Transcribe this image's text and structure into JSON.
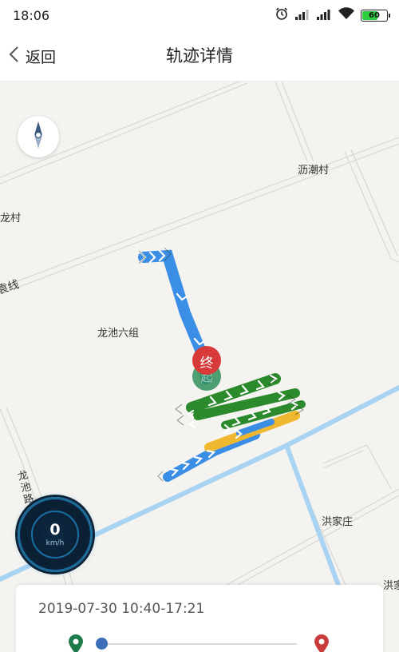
{
  "status_bar": {
    "time": "18:06",
    "battery": "60",
    "icons": [
      "alarm-icon",
      "signal-icon",
      "signal-icon",
      "wifi-icon",
      "battery-icon"
    ]
  },
  "header": {
    "back_label": "返回",
    "title": "轨迹详情"
  },
  "map": {
    "labels": {
      "lichao": "沥潮村",
      "longcun": "龙村",
      "yuanxian": "袁线",
      "longchi": "龙池六组",
      "longchilu": "龙池路",
      "hongjia": "洪家庄",
      "hongjia_edge": "洪家"
    },
    "end_marker": "终",
    "start_marker": "起",
    "colors": {
      "track_blue": "#3a8ee6",
      "track_green": "#2b8a2b",
      "track_yellow": "#f0b830",
      "end_red": "#d83a3a",
      "start_green": "#2f8f5a",
      "road_water": "#a9d3f2"
    }
  },
  "speed": {
    "value": "0",
    "unit": "km/h"
  },
  "info": {
    "time_range": "2019-07-30 10:40-17:21",
    "progress": 0
  }
}
